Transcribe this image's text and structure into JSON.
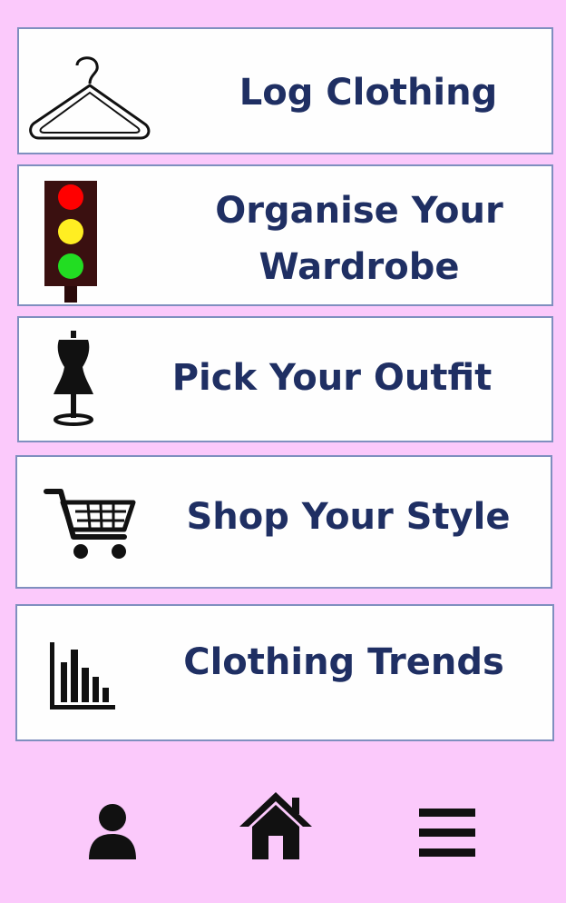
{
  "menu": {
    "items": [
      {
        "label": "Log Clothing",
        "icon": "hanger-icon"
      },
      {
        "label": "Organise Your\nWardrobe",
        "icon": "traffic-light-icon"
      },
      {
        "label": "Pick Your Outfit",
        "icon": "dress-form-icon"
      },
      {
        "label": "Shop Your Style",
        "icon": "shopping-cart-icon"
      },
      {
        "label": "Clothing Trends",
        "icon": "bar-chart-icon"
      }
    ]
  },
  "bottom_nav": {
    "items": [
      {
        "icon": "user-icon"
      },
      {
        "icon": "home-icon"
      },
      {
        "icon": "menu-icon"
      }
    ]
  },
  "colors": {
    "background": "#fbc9fb",
    "card_border": "#7f8fbf",
    "label_text": "#1f2f63",
    "traffic_red": "#ff0000",
    "traffic_yellow": "#ffee22",
    "traffic_green": "#22dd22"
  }
}
